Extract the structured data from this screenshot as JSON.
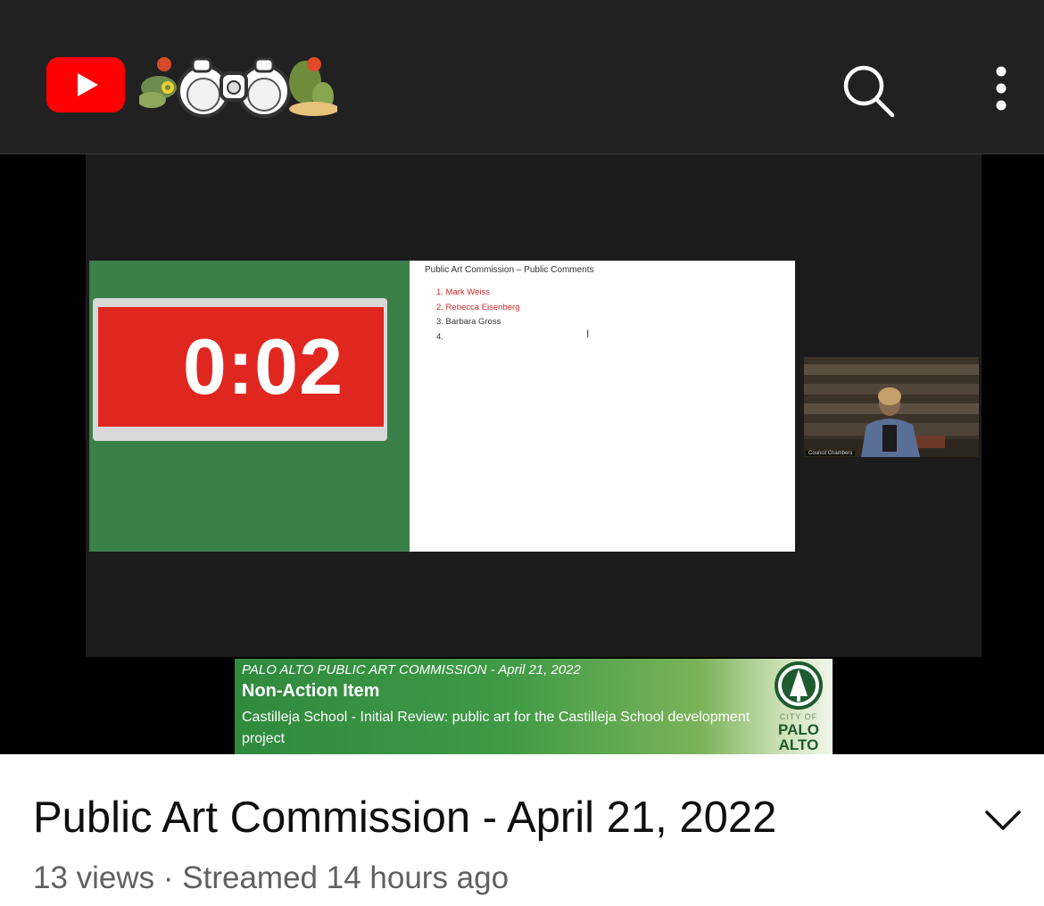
{
  "topbar": {
    "logo_icon": "youtube-play-icon",
    "doodle_icon": "binoculars-cactus-doodle",
    "search_icon": "search-icon",
    "more_icon": "more-vertical-icon"
  },
  "player": {
    "timer": "0:02",
    "doc": {
      "title": "Public Art Commission – Public Comments",
      "items": [
        {
          "text": "1. Mark Weiss",
          "color": "#d12a2a"
        },
        {
          "text": "2. Rebecca Eisenberg",
          "color": "#d12a2a"
        },
        {
          "text": "3. Barbara Gross",
          "color": "#333333"
        },
        {
          "text": "4.",
          "color": "#333333"
        }
      ],
      "cursor": "I"
    },
    "camera_caption": "Council Chambers",
    "lower_third": {
      "org": "PALO ALTO PUBLIC ART COMMISSION - April 21, 2022",
      "item_type": "Non-Action Item",
      "description": "Castilleja School - Initial Review: public art for the Castilleja School development project",
      "logo_city_of": "CITY OF",
      "logo_palo": "PALO",
      "logo_alto": "ALTO"
    }
  },
  "video": {
    "title": "Public Art Commission - April 21, 2022",
    "meta": "13 views · Streamed 14 hours ago",
    "expand_icon": "chevron-down-icon"
  },
  "colors": {
    "brand_red": "#ff0000",
    "timer_red": "#e0271f",
    "timer_green": "#3b7f49"
  }
}
